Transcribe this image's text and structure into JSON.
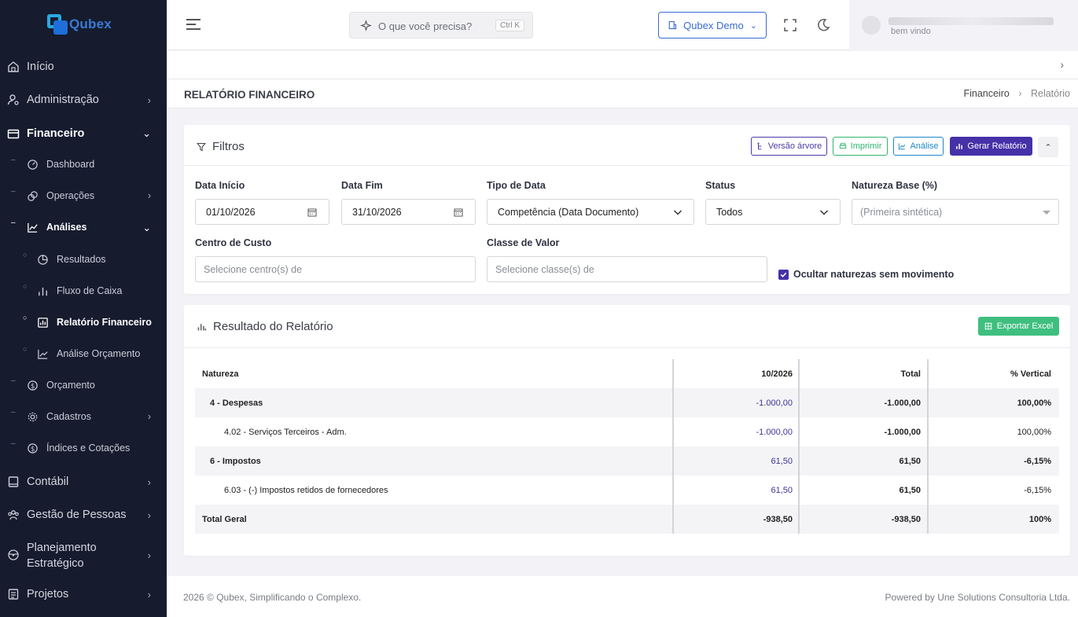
{
  "brand": {
    "name": "Qubex"
  },
  "sidebar": {
    "items": [
      {
        "label": "Início"
      },
      {
        "label": "Administração"
      },
      {
        "label": "Financeiro"
      },
      {
        "label": "Contábil"
      },
      {
        "label": "Gestão de Pessoas"
      },
      {
        "label": "Planejamento",
        "label2": "Estratégico"
      },
      {
        "label": "Projetos"
      }
    ],
    "financeiro_sub": [
      {
        "label": "Dashboard"
      },
      {
        "label": "Operações"
      },
      {
        "label": "Análises"
      },
      {
        "label": "Orçamento"
      },
      {
        "label": "Cadastros"
      },
      {
        "label": "Índices e Cotações"
      }
    ],
    "analises_sub": [
      {
        "label": "Resultados"
      },
      {
        "label": "Fluxo de Caixa"
      },
      {
        "label": "Relatório Financeiro"
      },
      {
        "label": "Análise Orçamento"
      }
    ]
  },
  "topbar": {
    "search_placeholder": "O que você precisa?",
    "search_shortcut": "Ctrl K",
    "company": "Qubex Demo",
    "welcome": "bem vindo"
  },
  "page": {
    "title": "RELATÓRIO FINANCEIRO",
    "breadcrumb": [
      "Financeiro",
      "Relatório"
    ]
  },
  "filters": {
    "title": "Filtros",
    "buttons": {
      "tree": "Versão árvore",
      "print": "Imprimir",
      "analysis": "Análise",
      "generate": "Gerar Relatório"
    },
    "fields": {
      "data_inicio": {
        "label": "Data Início",
        "value": "01/10/2026"
      },
      "data_fim": {
        "label": "Data Fim",
        "value": "31/10/2026"
      },
      "tipo_data": {
        "label": "Tipo de Data",
        "value": "Competência (Data Documento)"
      },
      "status": {
        "label": "Status",
        "value": "Todos"
      },
      "natureza_base": {
        "label": "Natureza Base (%)",
        "placeholder": "(Primeira sintética)"
      },
      "centro_custo": {
        "label": "Centro de Custo",
        "placeholder": "Selecione centro(s) de"
      },
      "classe_valor": {
        "label": "Classe de Valor",
        "placeholder": "Selecione classe(s) de"
      }
    },
    "checkbox_label": "Ocultar naturezas sem movimento",
    "checkbox_checked": true
  },
  "results": {
    "title": "Resultado do Relatório",
    "export_label": "Exportar Excel",
    "columns": [
      "Natureza",
      "10/2026",
      "Total",
      "% Vertical"
    ],
    "rows": [
      {
        "natureza": "4 - Despesas",
        "periodo": "-1.000,00",
        "total": "-1.000,00",
        "vertical": "100,00%"
      },
      {
        "natureza": "4.02 - Serviços Terceiros - Adm.",
        "periodo": "-1.000,00",
        "total": "-1.000,00",
        "vertical": "100,00%"
      },
      {
        "natureza": "6 - Impostos",
        "periodo": "61,50",
        "total": "61,50",
        "vertical": "-6,15%"
      },
      {
        "natureza": "6.03 - (-) Impostos retidos de fornecedores",
        "periodo": "61,50",
        "total": "61,50",
        "vertical": "-6,15%"
      }
    ],
    "total_row": {
      "natureza": "Total Geral",
      "periodo": "-938,50",
      "total": "-938,50",
      "vertical": "100%"
    }
  },
  "footer": {
    "left": "2026 © Qubex, Simplificando o Complexo.",
    "right": "Powered by Une Solutions Consultoria Ltda."
  }
}
